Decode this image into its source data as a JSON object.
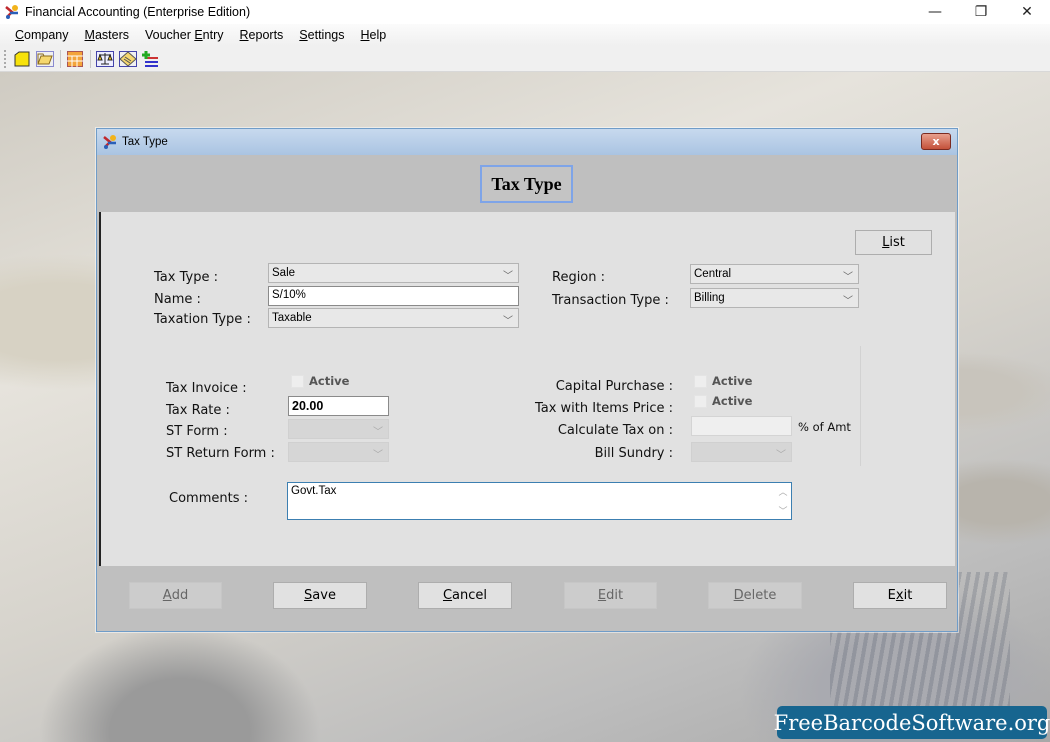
{
  "app": {
    "title": "Financial Accounting (Enterprise Edition)",
    "window_controls": {
      "minimize": "—",
      "restore": "❐",
      "close": "✕"
    }
  },
  "menu": {
    "items": [
      {
        "label": "Company",
        "mnemonic": "C",
        "rest": "ompany"
      },
      {
        "label": "Masters",
        "mnemonic": "M",
        "rest": "asters"
      },
      {
        "label": "Voucher Entry",
        "pre": "Voucher ",
        "mnemonic": "E",
        "rest": "ntry"
      },
      {
        "label": "Reports",
        "mnemonic": "R",
        "rest": "eports"
      },
      {
        "label": "Settings",
        "mnemonic": "S",
        "rest": "ettings"
      },
      {
        "label": "Help",
        "mnemonic": "H",
        "rest": "elp"
      }
    ]
  },
  "toolbar": {
    "icons": [
      "new-company-icon",
      "open-company-icon",
      "grid-icon",
      "balance-scale-icon",
      "notes-icon",
      "add-entry-icon"
    ]
  },
  "dialog": {
    "title": "Tax Type",
    "header": "Tax Type",
    "close_label": "x",
    "list_button": {
      "mnemonic": "L",
      "rest": "ist"
    },
    "fields": {
      "tax_type": {
        "label": "Tax Type :",
        "value": "Sale"
      },
      "name": {
        "label": "Name :",
        "value": "S/10%"
      },
      "taxation_type": {
        "label": "Taxation Type :",
        "value": "Taxable"
      },
      "region": {
        "label": "Region :",
        "value": "Central"
      },
      "transaction_type": {
        "label": "Transaction Type :",
        "value": "Billing"
      },
      "tax_invoice": {
        "label": "Tax Invoice :",
        "checkbox_label": "Active",
        "checked": false
      },
      "tax_rate": {
        "label": "Tax Rate :",
        "value": "20.00"
      },
      "st_form": {
        "label": "ST Form :",
        "value": ""
      },
      "st_return_form": {
        "label": "ST Return Form :",
        "value": ""
      },
      "capital_purchase": {
        "label": "Capital Purchase :",
        "checkbox_label": "Active",
        "checked": false
      },
      "tax_with_items_price": {
        "label": "Tax with Items Price :",
        "checkbox_label": "Active",
        "checked": false
      },
      "calculate_tax_on": {
        "label": "Calculate Tax on :",
        "value": "",
        "suffix": "% of Amt"
      },
      "bill_sundry": {
        "label": "Bill Sundry :",
        "value": ""
      },
      "comments": {
        "label": "Comments :",
        "value": "Govt.Tax"
      }
    },
    "buttons": [
      {
        "id": "add",
        "mnemonic": "A",
        "rest": "dd",
        "enabled": false
      },
      {
        "id": "save",
        "mnemonic": "S",
        "rest": "ave",
        "enabled": true
      },
      {
        "id": "cancel",
        "mnemonic": "C",
        "rest": "ancel",
        "enabled": true
      },
      {
        "id": "edit",
        "mnemonic": "E",
        "rest": "dit",
        "enabled": false
      },
      {
        "id": "delete",
        "mnemonic": "D",
        "rest": "elete",
        "enabled": false
      },
      {
        "id": "exit",
        "pre": "E",
        "mnemonic": "x",
        "rest": "it",
        "enabled": true
      }
    ]
  },
  "watermark": "FreeBarcodeSoftware.org",
  "colors": {
    "dialog_border": "#6f9cc8",
    "header_highlight": "#7ea4e8",
    "watermark_bg": "#17658f"
  }
}
